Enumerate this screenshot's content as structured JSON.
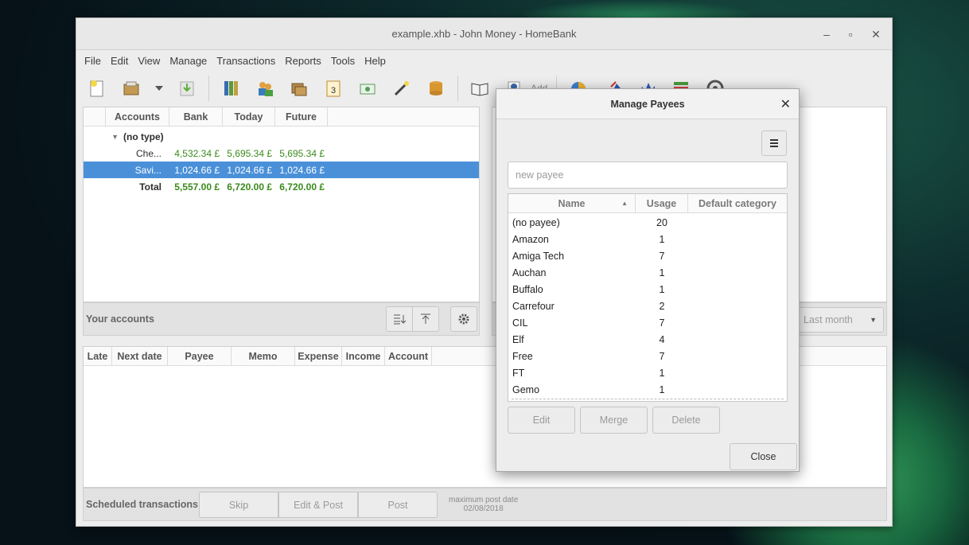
{
  "window": {
    "title": "example.xhb - John Money - HomeBank"
  },
  "menu": [
    "File",
    "Edit",
    "View",
    "Manage",
    "Transactions",
    "Reports",
    "Tools",
    "Help"
  ],
  "toolbar": {
    "add_label": "Add"
  },
  "accounts": {
    "headers": [
      "Accounts",
      "Bank",
      "Today",
      "Future"
    ],
    "group": "(no type)",
    "rows": [
      {
        "name": "Che...",
        "bank": "4,532.34 £",
        "today": "5,695.34 £",
        "future": "5,695.34 £"
      },
      {
        "name": "Savi...",
        "bank": "1,024.66 £",
        "today": "1,024.66 £",
        "future": "1,024.66 £"
      }
    ],
    "total": {
      "name": "Total",
      "bank": "5,557.00 £",
      "today": "6,720.00 £",
      "future": "6,720.00 £"
    },
    "footer_label": "Your accounts"
  },
  "right_panel": {
    "period": "Last month"
  },
  "scheduled": {
    "headers": [
      "Late",
      "Next date",
      "Payee",
      "Memo",
      "Expense",
      "Income",
      "Account"
    ],
    "footer_label": "Scheduled transactions",
    "skip": "Skip",
    "edit_post": "Edit & Post",
    "post": "Post",
    "max_post_label": "maximum post date",
    "max_post_date": "02/08/2018"
  },
  "dialog": {
    "title": "Manage Payees",
    "placeholder": "new payee",
    "headers": [
      "Name",
      "Usage",
      "Default category"
    ],
    "payees": [
      {
        "name": "(no payee)",
        "usage": "20"
      },
      {
        "name": "Amazon",
        "usage": "1"
      },
      {
        "name": "Amiga Tech",
        "usage": "7"
      },
      {
        "name": "Auchan",
        "usage": "1"
      },
      {
        "name": "Buffalo",
        "usage": "1"
      },
      {
        "name": "Carrefour",
        "usage": "2"
      },
      {
        "name": "CIL",
        "usage": "7"
      },
      {
        "name": "Elf",
        "usage": "4"
      },
      {
        "name": "Free",
        "usage": "7"
      },
      {
        "name": "FT",
        "usage": "1"
      },
      {
        "name": "Gemo",
        "usage": "1"
      }
    ],
    "edit": "Edit",
    "merge": "Merge",
    "delete": "Delete",
    "close": "Close"
  }
}
